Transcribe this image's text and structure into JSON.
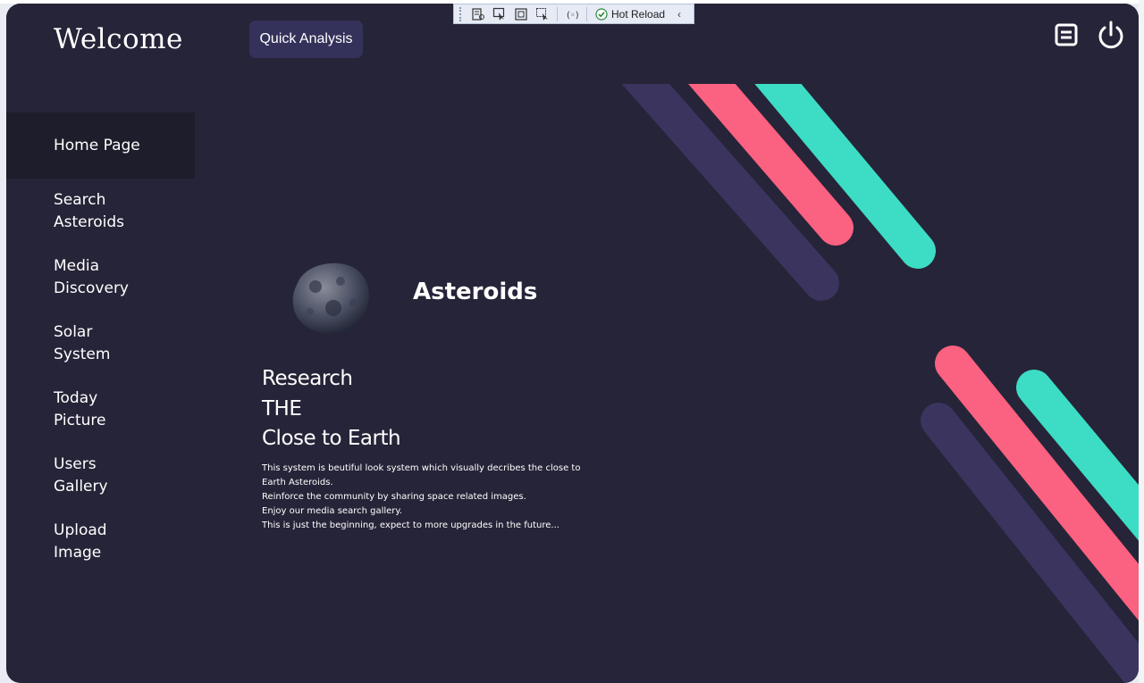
{
  "debug_toolbar": {
    "hot_reload_label": "Hot Reload",
    "buttons": [
      "live-visual-tree-icon",
      "select-element-icon",
      "display-layout-adorners-icon",
      "track-focus-icon",
      "binding-failures-icon"
    ]
  },
  "header": {
    "title": "Welcome",
    "quick_analysis_label": "Quick Analysis"
  },
  "sidebar": {
    "items": [
      {
        "label": "Home Page",
        "active": true
      },
      {
        "label": "Search Asteroids",
        "active": false
      },
      {
        "label": "Media Discovery",
        "active": false
      },
      {
        "label": "Solar System",
        "active": false
      },
      {
        "label": "Today Picture",
        "active": false
      },
      {
        "label": "Users Gallery",
        "active": false
      },
      {
        "label": "Upload Image",
        "active": false
      }
    ]
  },
  "main": {
    "title": "Asteroids",
    "headline": [
      "Research",
      "THE",
      "Close to Earth"
    ],
    "description": [
      "This system is beutiful look system which visually decribes the close to Earth Asteroids.",
      "Reinforce the community by sharing space related images.",
      "Enjoy our media search gallery.",
      "This is just the beginning, expect to more upgrades in the future..."
    ]
  },
  "colors": {
    "window_bg": "#262438",
    "active_nav_bg": "#1e1d2b",
    "button_bg": "#34325a",
    "stripe_purple": "#3a345f",
    "stripe_pink": "#fb6180",
    "stripe_teal": "#3ddcc4"
  }
}
